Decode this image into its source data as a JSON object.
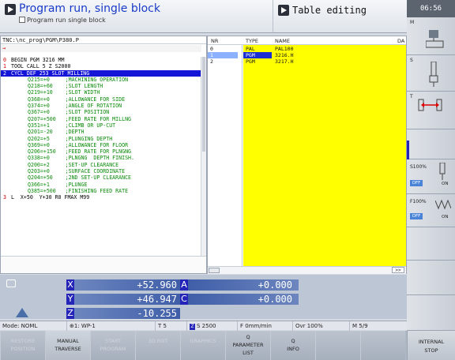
{
  "header": {
    "title": "Program run, single block",
    "subtitle": "Program run single block",
    "table_title": "Table editing",
    "clock": "06:56"
  },
  "program": {
    "path": "TNC:\\nc_prog\\PGM\\P380.P",
    "arrow": "→",
    "lines": [
      {
        "n": "0",
        "t": "BEGIN PGM 3216 MM",
        "type": "main"
      },
      {
        "n": "1",
        "t": "TOOL CALL 5 Z S2000",
        "type": "main"
      },
      {
        "n": "2",
        "t": "CYCL DEF 253 SLOT MILLING",
        "type": "sel"
      },
      {
        "n": "",
        "t": "Q215=+0     ;MACHINING OPERATION",
        "type": "par"
      },
      {
        "n": "",
        "t": "Q218=+60    ;SLOT LENGTH",
        "type": "par"
      },
      {
        "n": "",
        "t": "Q219=+10    ;SLOT WIDTH",
        "type": "par"
      },
      {
        "n": "",
        "t": "Q368=+0     ;ALLOWANCE FOR SIDE",
        "type": "par"
      },
      {
        "n": "",
        "t": "Q374=+0     ;ANGLE OF ROTATION",
        "type": "par"
      },
      {
        "n": "",
        "t": "Q367=+0     ;SLOT POSITION",
        "type": "par"
      },
      {
        "n": "",
        "t": "Q207=+500   ;FEED RATE FOR MILLNG",
        "type": "par"
      },
      {
        "n": "",
        "t": "Q351=+1     ;CLIMB OR UP-CUT",
        "type": "par"
      },
      {
        "n": "",
        "t": "Q201=-20    ;DEPTH",
        "type": "par"
      },
      {
        "n": "",
        "t": "Q202=+5     ;PLUNGING DEPTH",
        "type": "par"
      },
      {
        "n": "",
        "t": "Q369=+0     ;ALLOWANCE FOR FLOOR",
        "type": "par"
      },
      {
        "n": "",
        "t": "Q206=+150   ;FEED RATE FOR PLNGNG",
        "type": "par"
      },
      {
        "n": "",
        "t": "Q338=+0     ;PLNGNG  DEPTH FINISH.",
        "type": "par"
      },
      {
        "n": "",
        "t": "Q200=+2     ;SET-UP CLEARANCE",
        "type": "par"
      },
      {
        "n": "",
        "t": "Q203=+0     ;SURFACE COORDINATE",
        "type": "par"
      },
      {
        "n": "",
        "t": "Q204=+50    ;2ND SET-UP CLEARANCE",
        "type": "par"
      },
      {
        "n": "",
        "t": "Q366=+1     ;PLUNGE",
        "type": "par"
      },
      {
        "n": "",
        "t": "Q385=+500   ;FINISHING FEED RATE",
        "type": "par"
      },
      {
        "n": "3",
        "t": "L  X+50  Y+30 R0 FMAX M99",
        "type": "main"
      }
    ]
  },
  "table": {
    "headers": {
      "nr": "NR",
      "type": "TYPE",
      "name": "NAME",
      "extra": "DA"
    },
    "rows": [
      {
        "nr": "0",
        "type": "PAL",
        "name": "PAL100",
        "selected": false
      },
      {
        "nr": "1",
        "type": "PGM",
        "name": "3216.H",
        "selected": true
      },
      {
        "nr": "2",
        "type": "PGM",
        "name": "3217.H",
        "selected": false
      }
    ],
    "next_label": ">>"
  },
  "positions": [
    {
      "axis": "X",
      "value": "+52.960",
      "axis2": "A",
      "value2": "+0.000"
    },
    {
      "axis": "Y",
      "value": "+46.947",
      "axis2": "C",
      "value2": "+0.000"
    },
    {
      "axis": "Z",
      "value": "-10.255"
    }
  ],
  "status": {
    "mode": "Mode: NOML",
    "wp": "1: WP-1",
    "tool": "T 5",
    "spindle_axis": "Z",
    "spindle": "S 2500",
    "feed": "F 0mm/min",
    "ovr": "Ovr 100%",
    "m": "M 5/9"
  },
  "softkeys": [
    {
      "l1": "RESTORE",
      "l2": "POSITION",
      "disabled": true
    },
    {
      "l1": "MANUAL",
      "l2": "TRAVERSE",
      "disabled": false,
      "active": true
    },
    {
      "l1": "START",
      "l2": "PROGRAM",
      "disabled": true
    },
    {
      "l1": "3D ROT",
      "l2": "",
      "disabled": true
    },
    {
      "l1": "GRAPHICS",
      "l2": "",
      "disabled": true
    },
    {
      "l1": "Q",
      "l2": "PARAMETER",
      "l3": "LIST",
      "disabled": false
    },
    {
      "l1": "Q",
      "l2": "INFO",
      "disabled": false
    },
    {
      "l1": "",
      "l2": "",
      "disabled": false
    },
    {
      "l1": "",
      "l2": "",
      "disabled": false
    }
  ],
  "right_panel": {
    "m_label": "M",
    "s_label": "S",
    "t_label": "T",
    "s100_label": "S100%",
    "f100_label": "F100%",
    "off_label": "OFF",
    "on_label": "ON",
    "internal_l1": "INTERNAL",
    "internal_l2": "STOP"
  }
}
